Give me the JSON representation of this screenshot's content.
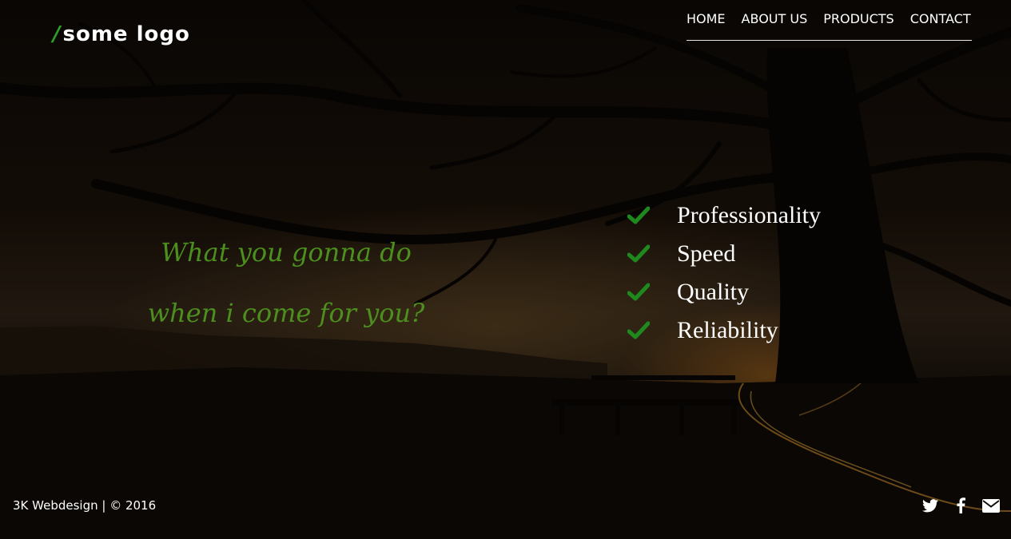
{
  "brand": {
    "logo_text": "some logo",
    "accent_color": "#2e9e26"
  },
  "nav": {
    "items": [
      {
        "label": "HOME"
      },
      {
        "label": "ABOUT US"
      },
      {
        "label": "PRODUCTS"
      },
      {
        "label": "CONTACT"
      }
    ]
  },
  "hero": {
    "slogan_line1": "What you gonna do",
    "slogan_line2": "when i come for you?",
    "slogan_color": "#4c8f1e"
  },
  "features": {
    "check_color": "#1e8a1e",
    "items": [
      {
        "label": "Professionality"
      },
      {
        "label": "Speed"
      },
      {
        "label": "Quality"
      },
      {
        "label": "Reliability"
      }
    ]
  },
  "footer": {
    "copyright": "3K Webdesign | © 2016",
    "social": [
      "twitter-icon",
      "facebook-icon",
      "envelope-icon"
    ]
  }
}
